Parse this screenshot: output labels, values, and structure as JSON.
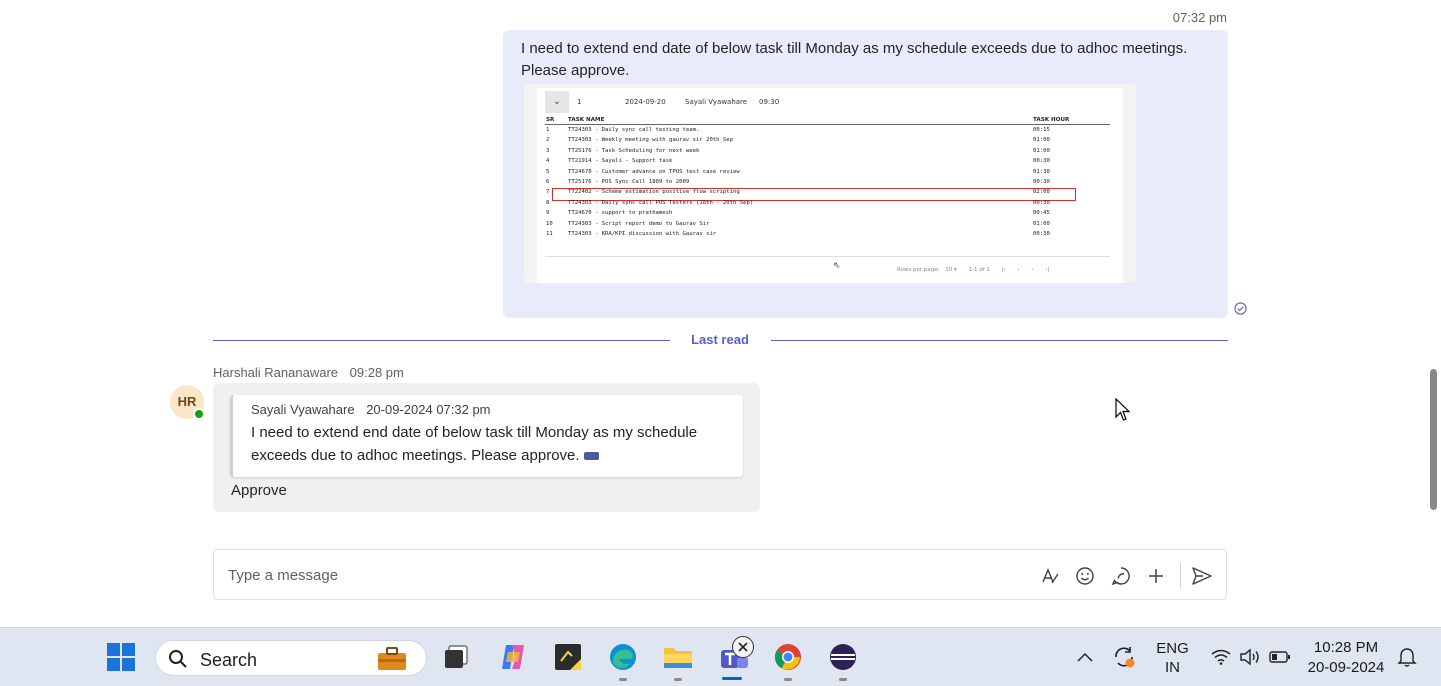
{
  "own_message": {
    "time": "07:32 pm",
    "text_line1": "I need to extend end date of below task till Monday as my schedule exceeds due to adhoc meetings.",
    "text_line2": "Please approve.",
    "screenshot": {
      "header": {
        "toggle": "⌄",
        "number": "1",
        "date": "2024-09-20",
        "name": "Sayali Vyawahare",
        "hours": "09:30"
      },
      "columns": {
        "sr": "SR",
        "task_name": "TASK NAME",
        "task_hour": "TASK HOUR"
      },
      "rows": [
        {
          "sr": "1",
          "task": "TT24303 - Daily sync call testing team.",
          "hour": "00:15"
        },
        {
          "sr": "2",
          "task": "TT24303 - Weekly meeting with gaurav sir 20th Sep",
          "hour": "01:00"
        },
        {
          "sr": "3",
          "task": "TT25176 - Task Scheduling for next week",
          "hour": "01:00"
        },
        {
          "sr": "4",
          "task": "TT21914 - Sayali - Support task",
          "hour": "00:30"
        },
        {
          "sr": "5",
          "task": "TT24670 - Customer advance on TPOS test case review",
          "hour": "01:30"
        },
        {
          "sr": "6",
          "task": "TT25176 - POS Sync Call 1809 to 2009",
          "hour": "00:30"
        },
        {
          "sr": "7",
          "task": "TT22402 - Scheme estimation positive flow scripting",
          "hour": "02:00"
        },
        {
          "sr": "8",
          "task": "TT24303 - Daily sync call POS Testers (18th - 20th Sep)",
          "hour": "00:30"
        },
        {
          "sr": "9",
          "task": "TT24670 - support to prathamesh",
          "hour": "00:45"
        },
        {
          "sr": "10",
          "task": "TT24303 - Script report demo to Gaurav Sir",
          "hour": "01:00"
        },
        {
          "sr": "11",
          "task": "TT24303 - KRA/KPI discussion with Gaurav sir",
          "hour": "00:30"
        }
      ],
      "highlighted_row": 7,
      "footer": {
        "rows_per_page_label": "Rows per page:",
        "rows_per_page": "10 ▾",
        "range": "1-1 of 1",
        "first": "|‹",
        "prev": "‹",
        "next": "›",
        "last": "›|"
      }
    }
  },
  "last_read": {
    "label": "Last read"
  },
  "reply": {
    "avatar_initials": "HR",
    "sender": "Harshali Rananaware",
    "time": "09:28 pm",
    "quote": {
      "sender": "Sayali Vyawahare",
      "timestamp": "20-09-2024 07:32 pm",
      "text": "I need to extend end date of below task till Monday as my schedule exceeds due to adhoc meetings. Please approve."
    },
    "text": "Approve"
  },
  "composer": {
    "placeholder": "Type a message"
  },
  "taskbar": {
    "search_label": "Search",
    "language_line1": "ENG",
    "language_line2": "IN",
    "time": "10:28 PM",
    "date": "20-09-2024"
  },
  "colors": {
    "accent": "#5b5fc7",
    "own_bubble": "#e8ebfa",
    "other_bubble": "#f0f0f0",
    "presence": "#13a10e",
    "highlight": "#d93025"
  }
}
